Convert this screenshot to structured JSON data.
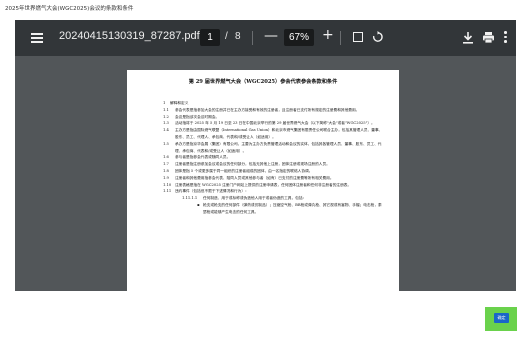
{
  "caption": "2025年世界燃气大会(WGC2025)会议的条款和条件",
  "viewer": {
    "toolbar": {
      "menu_icon": "hamburger-menu-icon",
      "title": "20240415130319_87287.pdf",
      "current_page": "1",
      "page_separator": "/",
      "total_pages": "8",
      "zoom_out": "—",
      "zoom_level": "67%",
      "zoom_in": "+",
      "fit_icon": "fit-to-page-icon",
      "rotate_icon": "rotate-icon",
      "download_icon": "download-icon",
      "print_icon": "print-icon",
      "more_icon": "more-vertical-icon"
    },
    "colors": {
      "toolbar": "#323639",
      "canvas": "#525659",
      "page": "#ffffff"
    }
  },
  "document": {
    "title": "第 29 届世界燃气大会（WGC2025）参会代表参会条款和条件",
    "section": {
      "num": "1",
      "text": "解释和定义"
    },
    "items": [
      {
        "num": "1.1",
        "text": "参会代表是指参加大会的注册并已在主办方接受和有效的注册者，且注册者已支付所有规定的注册费和其他费用。"
      },
      {
        "num": "1.2",
        "text": "会议是指该次会议时期会。"
      },
      {
        "num": "1.3",
        "text": "活动指将于 2025 年 5 月 19 日至 23 日在中国北京举行的第 29 届世界燃气大会（以下简称\"大会\"或者\"WGC2025\"）。"
      },
      {
        "num": "1.4",
        "text": "主办方是指由国际燃气联盟（International Gas Union）和北京市燃气集团有限责任公司联合主办，包括其管理人员、董事、股东、员工、代理人、承包商、代表和/或受让人（如适用）。"
      },
      {
        "num": "1.5",
        "text": "承办方是指京华会展（集团）有限公司，主要为主办方负责管理活动和会议的实体，包括其各管理人员、董事、股东、员工、代理、承包商、代表和/或受让人（如适用）。"
      },
      {
        "num": "1.6",
        "text": "参与者是指参会代表或随同人员。"
      },
      {
        "num": "1.7",
        "text": "注册者是指注册参加会议或会议的任何部分，包括无其他上注册，团体注册或现场注册的人员。"
      },
      {
        "num": "1.8",
        "text": "团体是指 5 个或更多属于同一组织的注册者组成的团体，由一名指定的联络人协调。"
      },
      {
        "num": "1.9",
        "text": "注册者和其他费用指参会代表、陪同人员或其他参与者（如有）已支付的注册费等所有相关费用。"
      },
      {
        "num": "1.10",
        "text": "注册表格是指在 WGC2025 注册门户网站上提供的注册申请表，任何团体注册者和任何非注册者的注册表。"
      },
      {
        "num": "1.11",
        "text": "违约事件（包括但不限于下述情况和行为）："
      }
    ],
    "sub_items": [
      {
        "num": "1.11.1.1",
        "text": "任何制造、用于或标称或伪造他人用于或者伪造的工具，包括："
      }
    ],
    "bullets": [
      {
        "num": "▪",
        "text": "枪支或枪支的任何部件（弹药或仿制品）；压缩空气枪、BB枪或弹丸枪、其它视或有害物、手榴；电击枪，泰瑟枪或能够产生电击的任何工具。"
      }
    ]
  },
  "confirm_button": {
    "label": "确定",
    "highlight_color": "#6ad24c",
    "button_color": "#1a67c9"
  }
}
